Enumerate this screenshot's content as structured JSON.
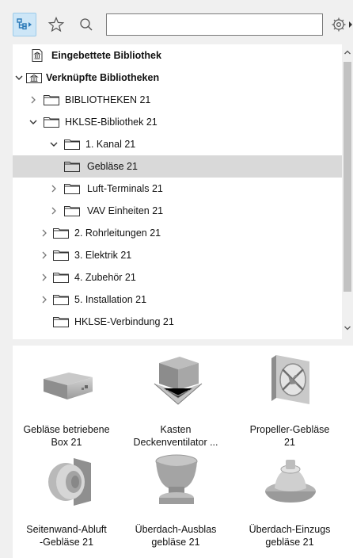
{
  "toolbar": {
    "search_value": "",
    "search_placeholder": "",
    "icons": [
      "tree-view-icon",
      "star-icon",
      "search-icon",
      "settings-icon"
    ]
  },
  "tree": {
    "items": [
      {
        "label": "Eingebettete Bibliothek",
        "bold": true,
        "icon": "library-icon",
        "expand": "none"
      },
      {
        "label": "Verknüpfte Bibliotheken",
        "bold": true,
        "icon": "library-icon",
        "expand": "expanded"
      },
      {
        "label": "BIBLIOTHEKEN 21",
        "bold": false,
        "icon": "folder-icon",
        "expand": "collapsed"
      },
      {
        "label": "HKLSE-Bibliothek 21",
        "bold": false,
        "icon": "folder-icon",
        "expand": "expanded"
      },
      {
        "label": "1. Kanal 21",
        "bold": false,
        "icon": "folder-icon",
        "expand": "expanded"
      },
      {
        "label": "Gebläse 21",
        "bold": false,
        "icon": "folder-icon",
        "expand": "none",
        "selected": true
      },
      {
        "label": "Luft-Terminals 21",
        "bold": false,
        "icon": "folder-icon",
        "expand": "collapsed"
      },
      {
        "label": "VAV Einheiten 21",
        "bold": false,
        "icon": "folder-icon",
        "expand": "collapsed"
      },
      {
        "label": "2. Rohrleitungen 21",
        "bold": false,
        "icon": "folder-icon",
        "expand": "collapsed"
      },
      {
        "label": "3. Elektrik 21",
        "bold": false,
        "icon": "folder-icon",
        "expand": "collapsed"
      },
      {
        "label": "4. Zubehör 21",
        "bold": false,
        "icon": "folder-icon",
        "expand": "collapsed"
      },
      {
        "label": "5. Installation 21",
        "bold": false,
        "icon": "folder-icon",
        "expand": "collapsed"
      },
      {
        "label": "HKLSE-Verbindung 21",
        "bold": false,
        "icon": "folder-icon",
        "expand": "none"
      }
    ]
  },
  "grid": {
    "items": [
      {
        "line1": "Gebläse betriebene",
        "line2": "Box 21",
        "icon": "box-fan-icon"
      },
      {
        "line1": "Kasten",
        "line2": "Deckenventilator ...",
        "icon": "ceiling-fan-icon"
      },
      {
        "line1": "Propeller-Gebläse",
        "line2": "21",
        "icon": "propeller-fan-icon"
      },
      {
        "line1": "Seitenwand-Abluft",
        "line2": "-Gebläse 21",
        "icon": "sidewall-fan-icon"
      },
      {
        "line1": "Überdach-Ausblas",
        "line2": "gebläse 21",
        "icon": "roof-exhaust-fan-icon"
      },
      {
        "line1": "Überdach-Einzugs",
        "line2": "gebläse 21",
        "icon": "roof-intake-fan-icon"
      }
    ]
  },
  "colors": {
    "selection": "#d9d9d9",
    "active_button": "#cde6f7",
    "panel": "#ffffff",
    "chrome": "#f0f0f0"
  }
}
